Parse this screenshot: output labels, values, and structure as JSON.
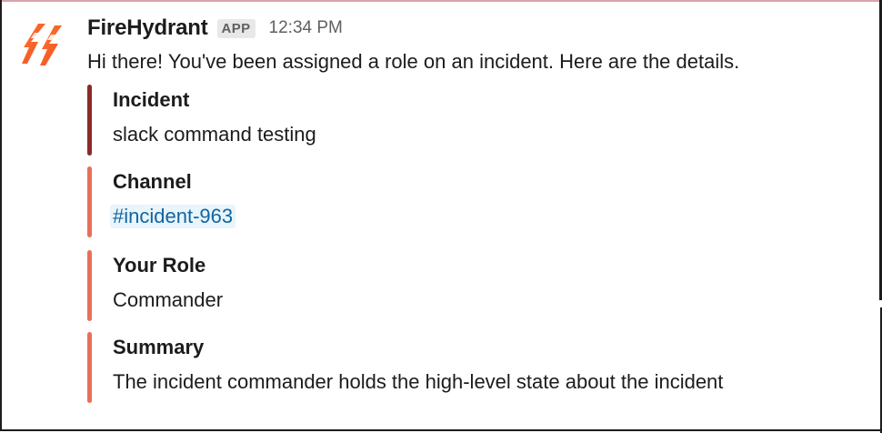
{
  "message": {
    "sender": "FireHydrant",
    "badge": "APP",
    "timestamp": "12:34 PM",
    "avatar_icon": "firehydrant-logo-icon",
    "intro": "Hi there! You've been assigned a role on an incident. Here are the details."
  },
  "fields": [
    {
      "label": "Incident",
      "value": "slack command testing",
      "bar_color": "#8b2a2a"
    },
    {
      "label": "Channel",
      "value": "#incident-963",
      "bar_color": "#e8705a"
    },
    {
      "label": "Your Role",
      "value": "Commander",
      "bar_color": "#e8705a"
    },
    {
      "label": "Summary",
      "value": "The incident commander holds the high-level state about the incident",
      "bar_color": "#e8705a"
    }
  ],
  "colors": {
    "link": "#1264a3",
    "brand": "#f05a28"
  }
}
